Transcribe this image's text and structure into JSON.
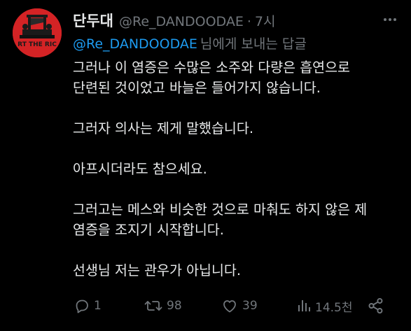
{
  "tweet": {
    "display_name": "단두대",
    "handle": "@Re_DANDOODAE",
    "separator": "·",
    "time": "7시",
    "reply_to": {
      "mention": "@Re_DANDOODAE",
      "suffix": "님에게 보내는 답글"
    },
    "avatar_text": "RT THE RIC",
    "lines": [
      "그러나 이 염증은 수많은 소주와 다량은 흡연으로",
      "단련된 것이었고 바늘은 들어가지 않습니다.",
      "",
      "그러자 의사는 제게 말했습니다.",
      "",
      "아프시더라도 참으세요.",
      "",
      "그러고는 메스와 비슷한 것으로 마춰도 하지 않은 제",
      "염증을 조지기 시작합니다.",
      "",
      "선생님 저는 관우가 아닙니다."
    ],
    "actions": {
      "reply_count": "1",
      "retweet_count": "98",
      "like_count": "39",
      "view_count": "14.5천"
    }
  },
  "colors": {
    "background": "#000000",
    "text": "#e7e9ea",
    "muted": "#71767b",
    "link": "#1d9bf0",
    "avatar_bg": "#d42325"
  },
  "icons": {
    "more": "more-icon",
    "reply": "reply-icon",
    "retweet": "retweet-icon",
    "like": "like-icon",
    "views": "views-icon",
    "share": "share-icon"
  }
}
